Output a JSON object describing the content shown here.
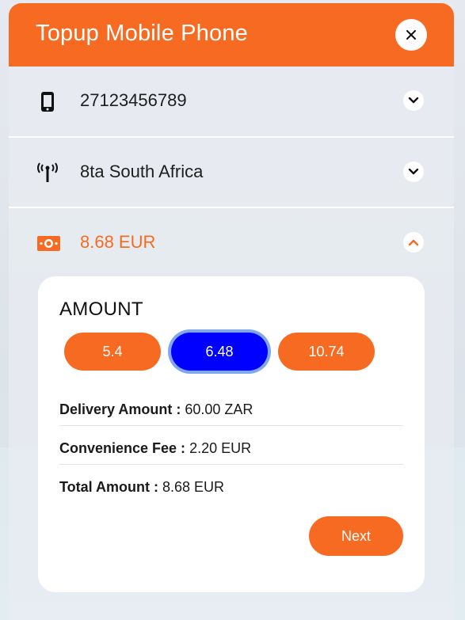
{
  "header": {
    "title": "Topup Mobile Phone",
    "close_icon": "close-icon"
  },
  "sections": {
    "phone": {
      "label": "27123456789",
      "icon": "mobile-phone-icon",
      "expanded": false
    },
    "operator": {
      "label": "8ta South Africa",
      "icon": "antenna-signal-icon",
      "expanded": false
    },
    "amount": {
      "label": "8.68 EUR",
      "icon": "banknote-icon",
      "expanded": true
    }
  },
  "amount_card": {
    "title": "AMOUNT",
    "options": [
      "5.4",
      "6.48",
      "10.74"
    ],
    "selected": "6.48",
    "delivery_label": "Delivery Amount :",
    "delivery_value": "60.00 ZAR",
    "fee_label": "Convenience Fee :",
    "fee_value": "2.20 EUR",
    "total_label": "Total Amount :",
    "total_value": "8.68 EUR",
    "next_label": "Next"
  },
  "colors": {
    "accent": "#f76a21",
    "selected": "#0000ff",
    "selected_ring": "#7fa6ee"
  }
}
